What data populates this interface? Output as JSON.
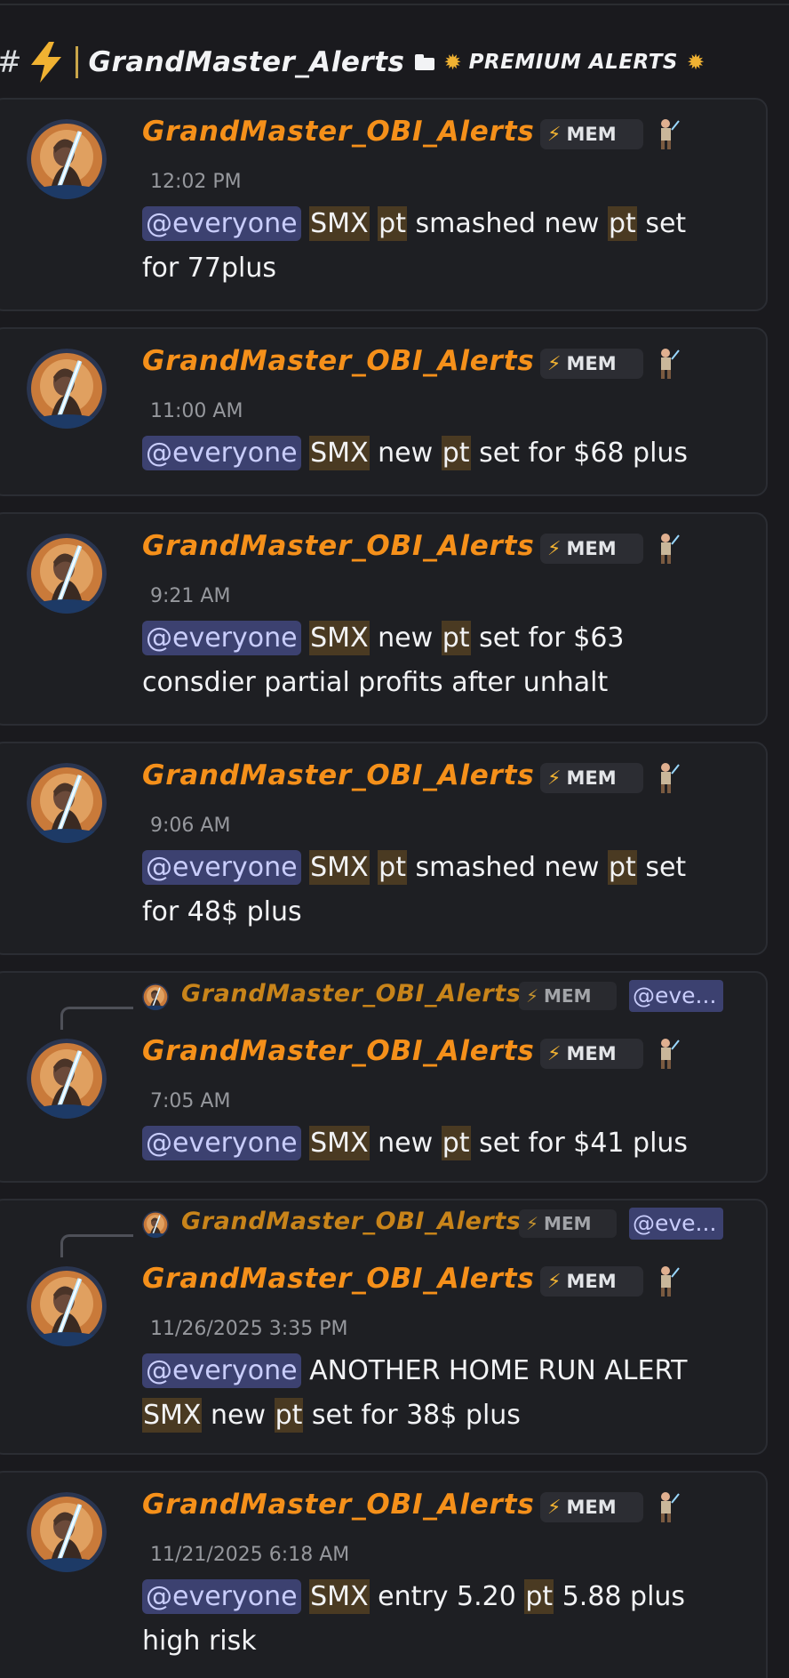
{
  "channel": {
    "hash": "#",
    "name": "GrandMaster_Alerts",
    "category": "PREMIUM ALERTS",
    "icons": [
      "lightning-icon",
      "folder-icon",
      "sun-icon"
    ]
  },
  "author": {
    "name": "GrandMaster_OBI_Alerts",
    "tag": "MEM",
    "tag_icon": "lightning-icon",
    "badge_icon": "jedi-figure-icon",
    "avatar_icon": "jedi-avatar"
  },
  "messages": [
    {
      "time": "12:02 PM",
      "mention": "@everyone",
      "parts": [
        " ",
        "SMX",
        " ",
        "pt",
        " smashed new ",
        "pt",
        " set for 77plus"
      ]
    },
    {
      "time": "11:00 AM",
      "mention": "@everyone",
      "parts": [
        " ",
        "SMX",
        " new ",
        "pt",
        " set for $68 plus"
      ]
    },
    {
      "time": "9:21 AM",
      "mention": "@everyone",
      "parts": [
        " ",
        "SMX",
        " new ",
        "pt",
        " set for $63 consdier partial profits after unhalt"
      ]
    },
    {
      "time": "9:06 AM",
      "mention": "@everyone",
      "parts": [
        " ",
        "SMX",
        " ",
        "pt",
        " smashed new ",
        "pt",
        " set for 48$ plus"
      ]
    },
    {
      "time": "7:05 AM",
      "mention": "@everyone",
      "parts": [
        " ",
        "SMX",
        " new ",
        "pt",
        " set for $41 plus"
      ],
      "reply": {
        "name": "GrandMaster_OBI_Alerts",
        "tag": "MEM",
        "mention": "@eve..."
      }
    },
    {
      "time": "11/26/2025 3:35 PM",
      "mention": "@everyone",
      "parts": [
        " ANOTHER HOME RUN ALERT ",
        "SMX",
        " new ",
        "pt",
        " set for 38$ plus"
      ],
      "reply": {
        "name": "GrandMaster_OBI_Alerts",
        "tag": "MEM",
        "mention": "@eve..."
      }
    },
    {
      "time": "11/21/2025 6:18 AM",
      "mention": "@everyone",
      "parts": [
        " ",
        "SMX",
        " entry 5.20 ",
        "pt",
        " 5.88 plus high risk"
      ]
    }
  ],
  "colors": {
    "background": "#1a1a1e",
    "card": "#1e1f23",
    "username": "#f5901a",
    "mention_bg": "#3c4170",
    "highlight_bg": "#4a3a22",
    "timestamp": "#96989d",
    "bolt": "#f0b232"
  }
}
